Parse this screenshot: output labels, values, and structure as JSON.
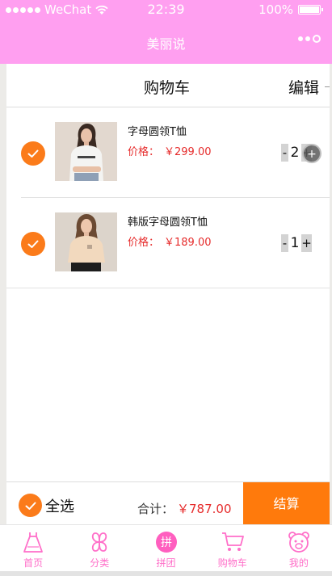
{
  "status_bar": {
    "carrier": "WeChat",
    "time": "22:39",
    "battery_percent": "100%"
  },
  "nav": {
    "title": "美丽说"
  },
  "cart": {
    "title": "购物车",
    "edit_label": "编辑",
    "items": [
      {
        "name": "字母圆领T恤",
        "price_label": "价格：",
        "price": "￥299.00",
        "minus": "-",
        "quantity": "2",
        "plus": "+",
        "checked": true
      },
      {
        "name": "韩版字母圆领T恤",
        "price_label": "价格：",
        "price": "￥189.00",
        "minus": "-",
        "quantity": "1",
        "plus": "+",
        "checked": true
      }
    ]
  },
  "footer": {
    "select_all_label": "全选",
    "total_label": "合计：",
    "total_amount": "￥787.00",
    "checkout_label": "结算"
  },
  "tabs": [
    {
      "label": "首页",
      "icon": "dress-icon"
    },
    {
      "label": "分类",
      "icon": "clover-icon"
    },
    {
      "label": "拼团",
      "icon": "group-buy-icon",
      "glyph": "拼"
    },
    {
      "label": "购物车",
      "icon": "cart-icon"
    },
    {
      "label": "我的",
      "icon": "bear-icon"
    }
  ],
  "colors": {
    "header_pink": "#ff9ff0",
    "accent_orange": "#fb7b1a",
    "price_red": "#e62b2b",
    "tab_pink": "#ff6fc9"
  }
}
